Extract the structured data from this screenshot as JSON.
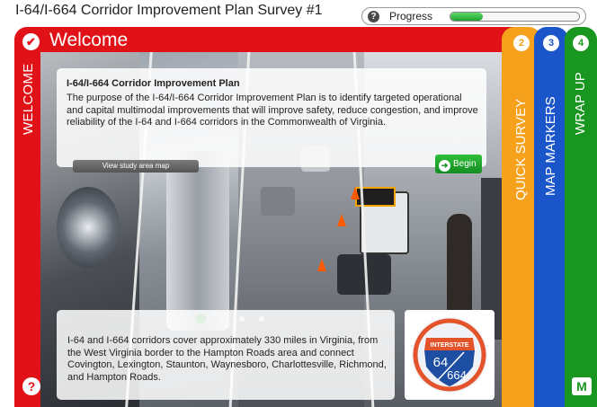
{
  "header": {
    "title": "I-64/I-664 Corridor Improvement Plan Survey #1",
    "progress_label": "Progress",
    "progress_fraction": 0.25
  },
  "welcome": {
    "heading": "Welcome",
    "vertical_label": "WELCOME",
    "card_title": "I-64/I-664 Corridor Improvement Plan",
    "card_body": "The purpose of the I-64/I-664 Corridor Improvement Plan is to identify targeted operational and capital multimodal improvements that will improve safety, reduce congestion, and improve reliability of the I-64 and I-664 corridors in the Commonwealth of Virginia.",
    "map_button": "View study area map",
    "begin_button": "Begin",
    "slide_text": "I-64 and I-664 corridors cover approximately 330 miles in Virginia, from the West Virginia border to the Hampton Roads area and connect Covington, Lexington, Staunton, Waynesboro, Charlottesville, Richmond, and Hampton Roads.",
    "slides_total": 4,
    "active_slide": 1,
    "shield": {
      "banner": "INTERSTATE",
      "num1": "64",
      "num2": "664"
    }
  },
  "tabs": [
    {
      "number": "2",
      "label": "QUICK SURVEY",
      "color": "#f5a11c"
    },
    {
      "number": "3",
      "label": "MAP MARKERS",
      "color": "#1a55c9"
    },
    {
      "number": "4",
      "label": "WRAP UP",
      "color": "#18961f"
    }
  ],
  "colors": {
    "welcome_red": "#e01217",
    "progress_green": "#1fa32e"
  },
  "icons": {
    "help": "question-circle-icon",
    "check": "check-circle-icon",
    "begin": "arrow-right-circle-icon",
    "logo": "metroquest-logo-icon"
  }
}
